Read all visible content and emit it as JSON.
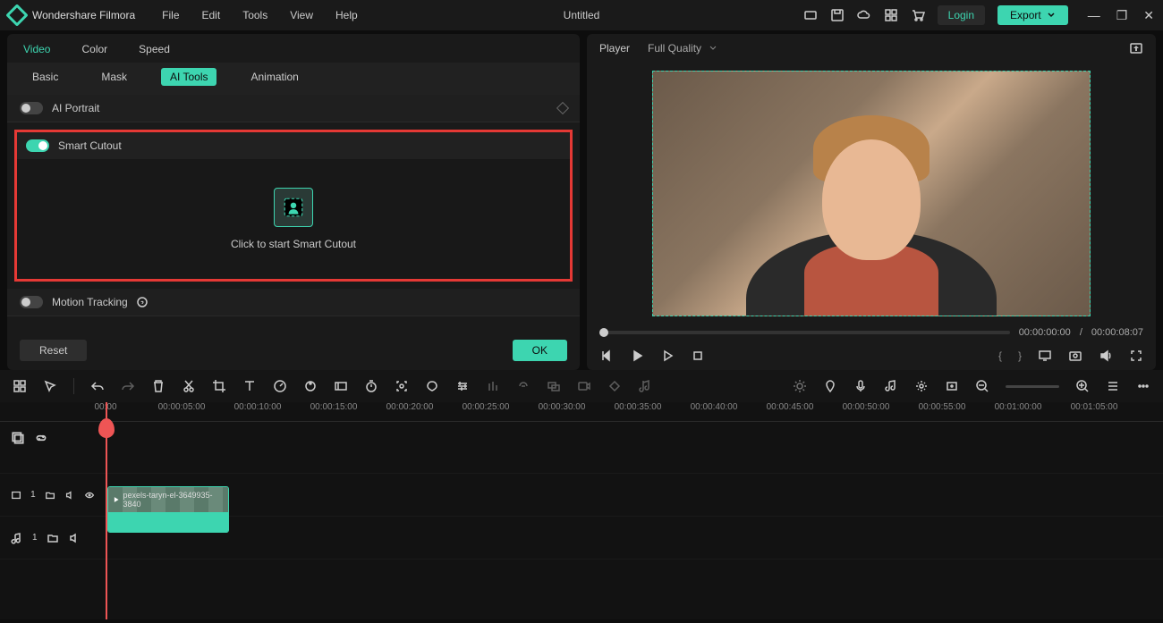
{
  "app": {
    "name": "Wondershare Filmora",
    "doc_title": "Untitled"
  },
  "menu": [
    "File",
    "Edit",
    "Tools",
    "View",
    "Help"
  ],
  "titlebar_buttons": {
    "login": "Login",
    "export": "Export"
  },
  "left_tabs_primary": [
    "Video",
    "Color",
    "Speed"
  ],
  "left_tabs_secondary": [
    "Basic",
    "Mask",
    "AI Tools",
    "Animation"
  ],
  "active_primary": "Video",
  "active_secondary": "AI Tools",
  "sections": {
    "ai_portrait": "AI Portrait",
    "smart_cutout": "Smart Cutout",
    "smart_cutout_hint": "Click to start Smart Cutout",
    "motion_tracking": "Motion Tracking"
  },
  "buttons": {
    "reset": "Reset",
    "ok": "OK"
  },
  "player": {
    "label": "Player",
    "quality": "Full Quality",
    "time_current": "00:00:00:00",
    "time_sep": "/",
    "time_total": "00:00:08:07"
  },
  "ruler_marks": [
    "00:00",
    "00:00:05:00",
    "00:00:10:00",
    "00:00:15:00",
    "00:00:20:00",
    "00:00:25:00",
    "00:00:30:00",
    "00:00:35:00",
    "00:00:40:00",
    "00:00:45:00",
    "00:00:50:00",
    "00:00:55:00",
    "00:01:00:00",
    "00:01:05:00"
  ],
  "clip_label": "pexels-taryn-el-3649935-3840",
  "track_video_num": "1",
  "track_audio_num": "1"
}
